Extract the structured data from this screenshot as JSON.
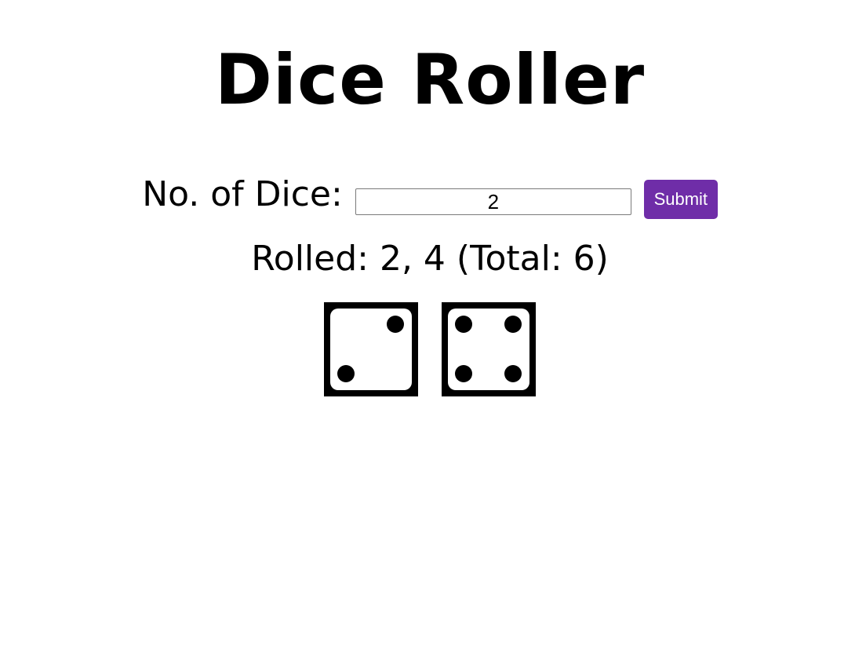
{
  "title": "Dice Roller",
  "form": {
    "label": "No. of Dice:",
    "input_value": "2",
    "submit_label": "Submit"
  },
  "result": {
    "text": "Rolled: 2, 4 (Total: 6)"
  },
  "dice": [
    {
      "value": 2,
      "icon": "die-face-2-icon"
    },
    {
      "value": 4,
      "icon": "die-face-4-icon"
    }
  ],
  "colors": {
    "accent": "#6f2da8",
    "die_border": "#000000",
    "pip": "#000000"
  }
}
